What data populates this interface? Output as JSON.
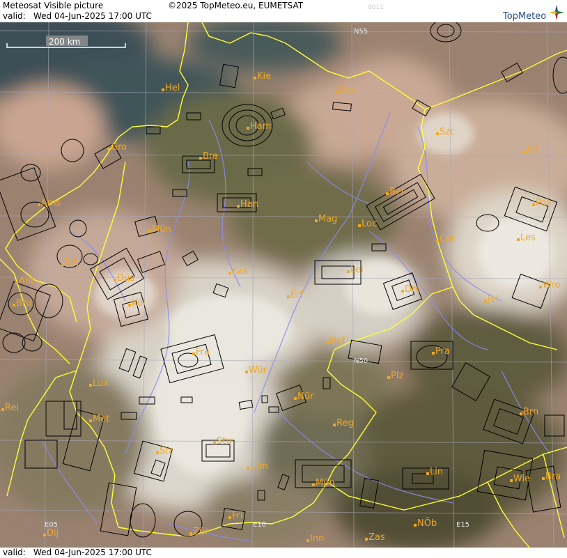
{
  "header": {
    "title": "Meteosat Visible picture",
    "valid_label": "valid:",
    "valid_datetime": "Wed  04-Jun-2025  17:00 UTC",
    "copyright": "©2025 TopMeteo.eu, EUMETSAT",
    "code": "8011",
    "logo_text": "TopMeteo"
  },
  "footer": {
    "valid_label": "valid:",
    "valid_datetime": "Wed  04-Jun-2025  17:00 UTC"
  },
  "map": {
    "scale_label": "200 km",
    "grid_labels": [
      "N55",
      "N50",
      "E05",
      "E10",
      "E15"
    ],
    "cities": [
      "Hel",
      "Kie",
      "Ros",
      "Ham",
      "Szc",
      "Gro",
      "Bre",
      "Pil",
      "Ams",
      "Han",
      "Ber",
      "Poz",
      "Mün",
      "Mag",
      "Loc",
      "Cot",
      "Les",
      "Ein",
      "Kas",
      "Lei",
      "Ant",
      "Düs",
      "Dre",
      "Wro",
      "Bru",
      "Köl",
      "Erf",
      "Jel",
      "Hof",
      "Fra",
      "Pra",
      "Wür",
      "Plz",
      "Lux",
      "Rei",
      "Nür",
      "Met",
      "Reg",
      "Brn",
      "Stu",
      "Str",
      "Ulm",
      "Lin",
      "Mün",
      "Wie",
      "Bra",
      "Fri",
      "Zür",
      "Dij",
      "Inn",
      "Zas",
      "NÖb"
    ],
    "colors": {
      "coast": "#ffff33",
      "rivers": "#8a8cf0",
      "grid": "#a8a8b8",
      "city_text": "#f0a828",
      "airspace": "#000000"
    }
  }
}
